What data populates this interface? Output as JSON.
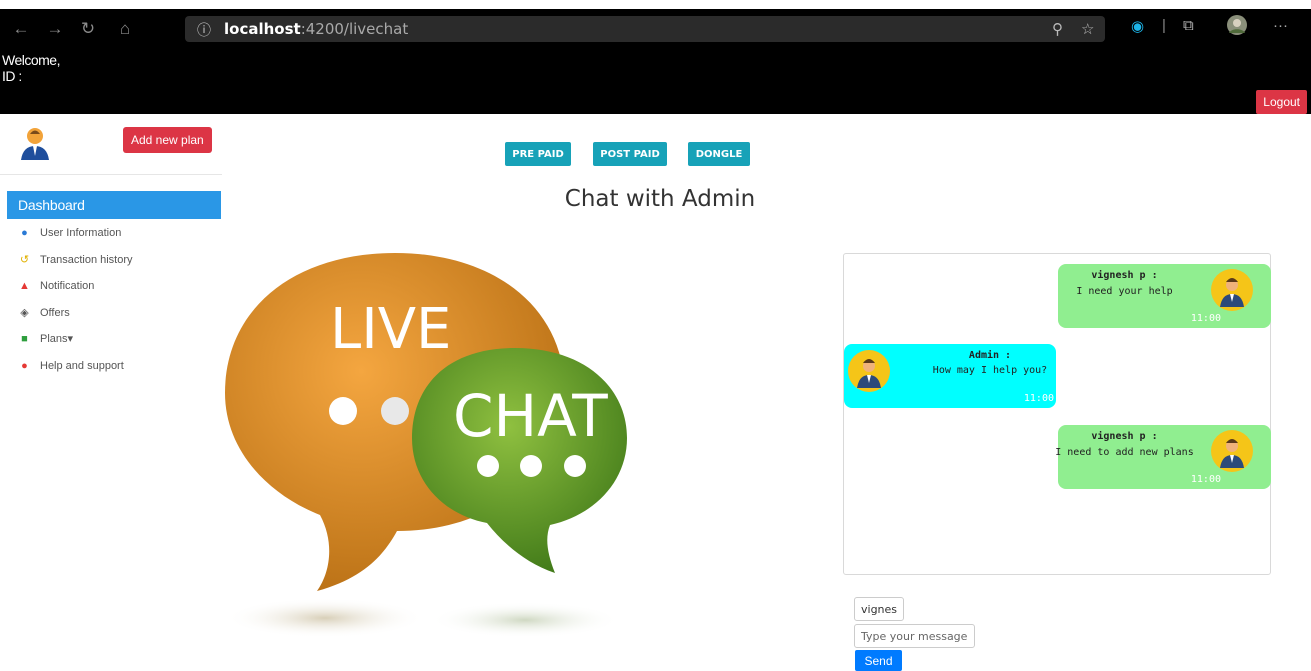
{
  "browser": {
    "url_host": "localhost",
    "url_path": ":4200/livechat",
    "info_icon": "info-icon",
    "icons": [
      "back-arrow-icon",
      "forward-arrow-icon",
      "refresh-icon",
      "home-icon",
      "zoom-icon",
      "star-icon",
      "extension-icon",
      "collections-icon",
      "profile-avatar-icon",
      "more-icon"
    ]
  },
  "header": {
    "welcome": "Welcome,",
    "id_label": "ID :",
    "logout_label": "Logout"
  },
  "sidebar": {
    "add_plan_label": "Add new plan",
    "active_item": "Dashboard",
    "items": [
      {
        "label": "User Information",
        "icon": "user-icon",
        "color": "#2a7ad5"
      },
      {
        "label": "Transaction history",
        "icon": "history-icon",
        "color": "#e0b100"
      },
      {
        "label": "Notification",
        "icon": "bell-icon",
        "color": "#e53935"
      },
      {
        "label": "Offers",
        "icon": "diamond-icon",
        "color": "#555555"
      },
      {
        "label": "Plans▾",
        "icon": "book-icon",
        "color": "#2e9e3d"
      },
      {
        "label": "Help and support",
        "icon": "chat-bubble-icon",
        "color": "#e53935"
      }
    ]
  },
  "plans": {
    "prepaid": "PRE PAID",
    "postpaid": "POST PAID",
    "dongle": "DONGLE"
  },
  "page_title": "Chat with Admin",
  "illustration": {
    "word1": "LIVE",
    "word2": "CHAT"
  },
  "messages": [
    {
      "sender": "vignesh p :",
      "text": "I need your help",
      "time": "11:00",
      "side": "right"
    },
    {
      "sender": "Admin :",
      "text": "How may I help you?",
      "time": "11:00",
      "side": "left"
    },
    {
      "sender": "vignesh p :",
      "text": "I need to add new plans",
      "time": "11:00",
      "side": "right"
    }
  ],
  "form": {
    "name_value": "vignes",
    "message_placeholder": "Type your message",
    "send_label": "Send"
  },
  "colors": {
    "accent_blue": "#2a97e6",
    "danger": "#dc3545",
    "teal": "#17a2b8",
    "user_bubble": "#90ee90",
    "admin_bubble": "#00ffff",
    "primary": "#007bff"
  }
}
